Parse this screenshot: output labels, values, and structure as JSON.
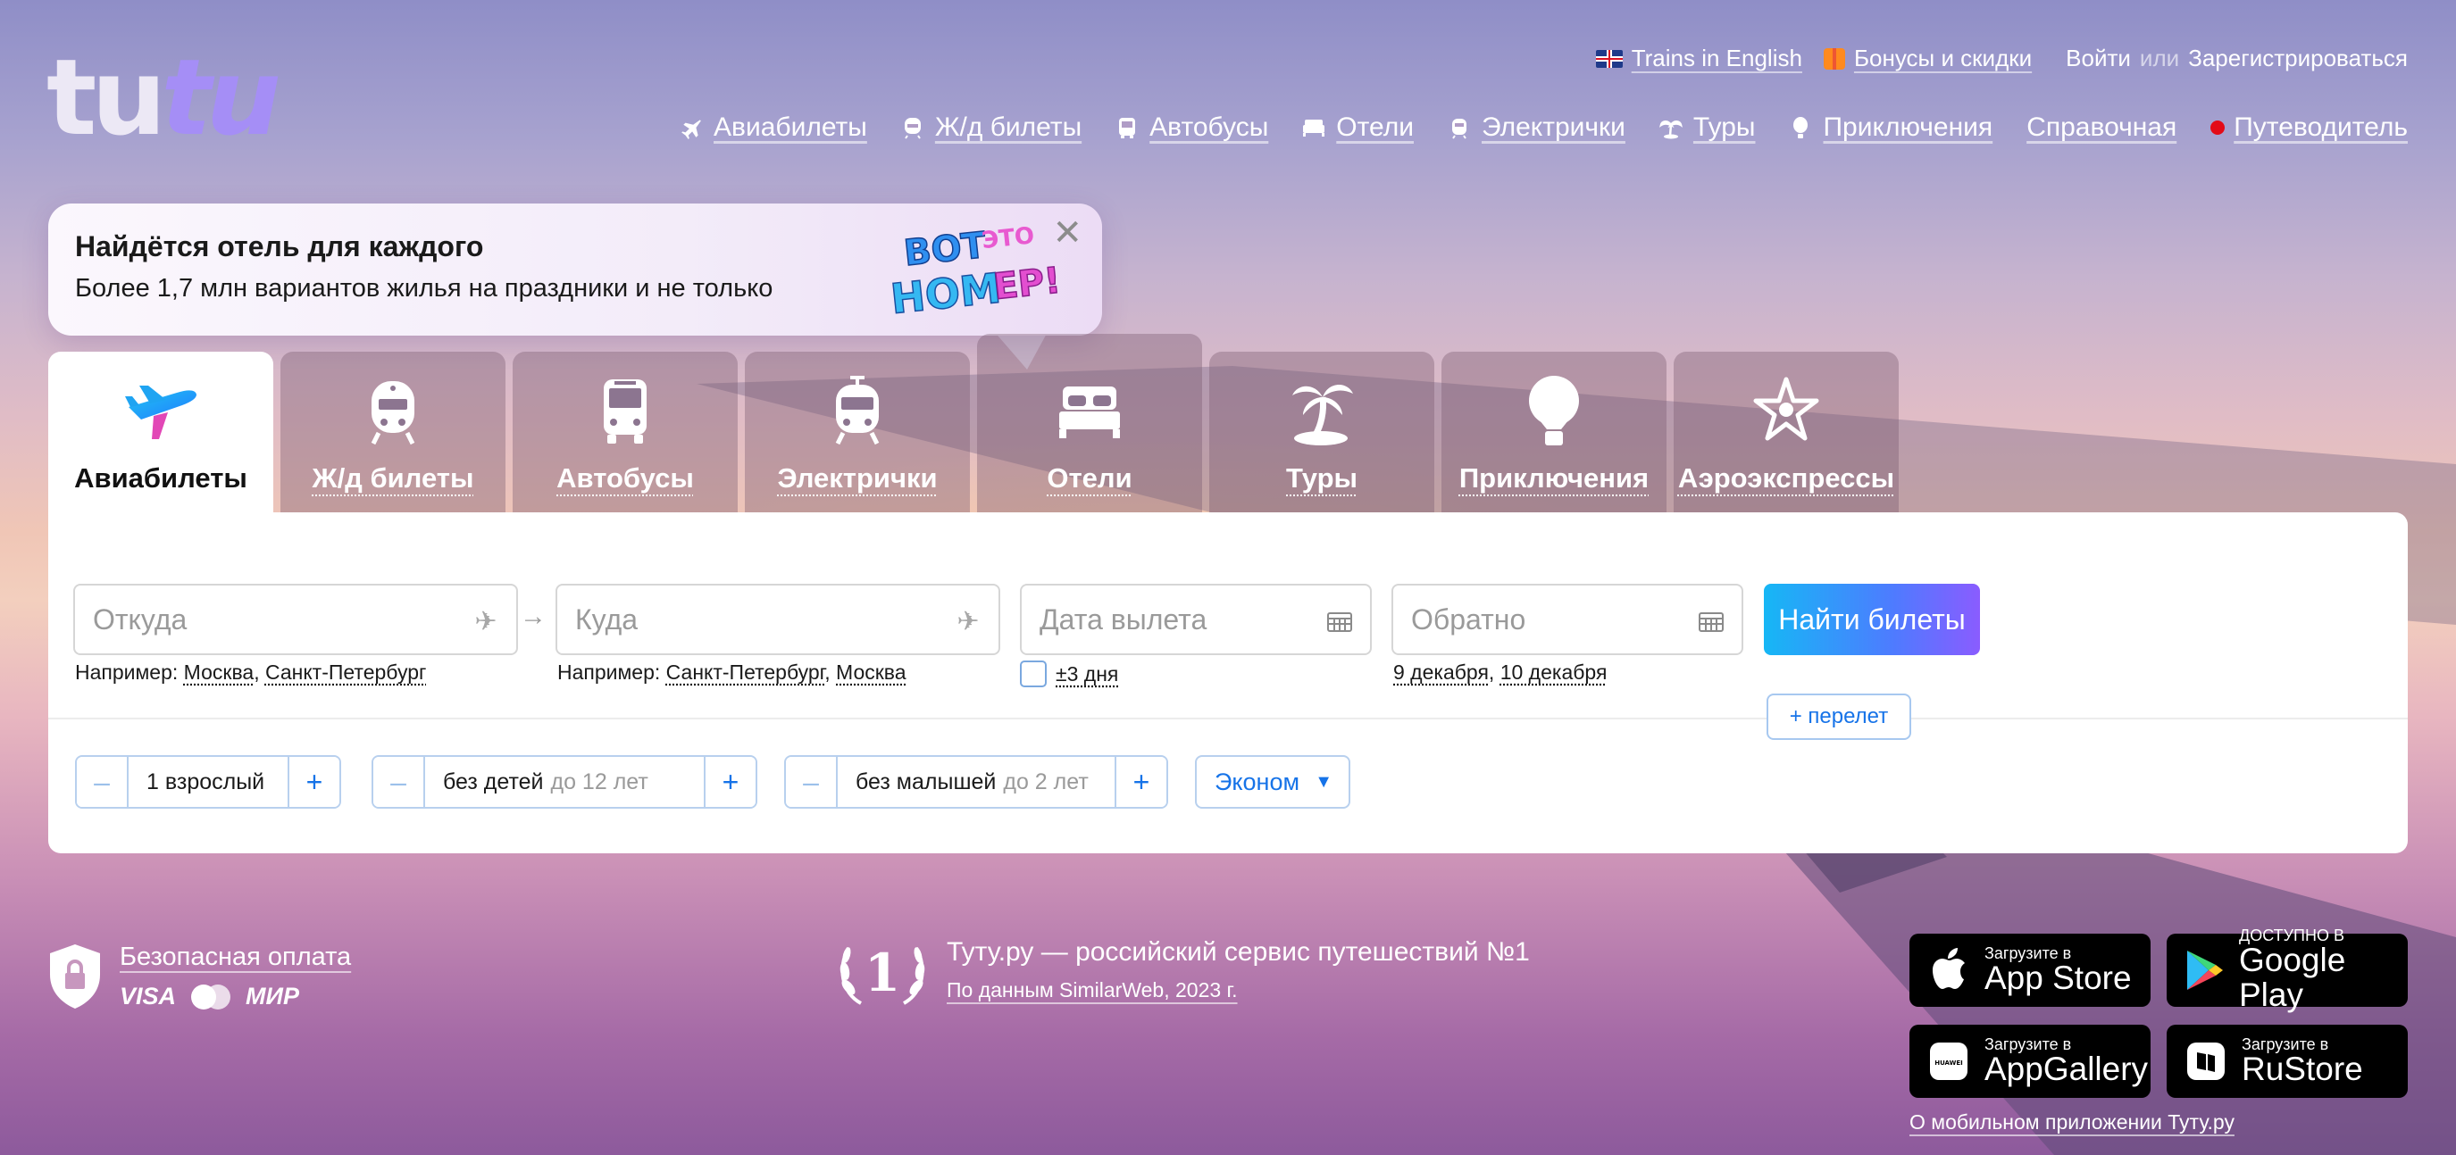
{
  "logo": {
    "part1": "tu",
    "part2": "tu"
  },
  "toplinks": {
    "trains_english": "Trains in English",
    "bonuses": "Бонусы и скидки",
    "login": "Войти",
    "or": "или",
    "register": "Зарегистрироваться"
  },
  "nav": [
    {
      "label": "Авиабилеты",
      "icon": "plane-icon"
    },
    {
      "label": "Ж/д билеты",
      "icon": "train-icon"
    },
    {
      "label": "Автобусы",
      "icon": "bus-icon"
    },
    {
      "label": "Отели",
      "icon": "bed-icon"
    },
    {
      "label": "Электрички",
      "icon": "suburban-train-icon"
    },
    {
      "label": "Туры",
      "icon": "palm-icon"
    },
    {
      "label": "Приключения",
      "icon": "balloon-icon"
    },
    {
      "label": "Справочная",
      "icon": ""
    },
    {
      "label": "Путеводитель",
      "icon": "red-dot"
    }
  ],
  "promo": {
    "title": "Найдётся отель для каждого",
    "subtitle": "Более 1,7 млн вариантов жилья на праздники и не только",
    "badge": "ВОТ ЭТО НОМЕР!",
    "close": "✕"
  },
  "tabs": [
    {
      "label": "Авиабилеты",
      "icon": "plane-icon",
      "active": true
    },
    {
      "label": "Ж/д билеты",
      "icon": "train-icon"
    },
    {
      "label": "Автобусы",
      "icon": "bus-icon"
    },
    {
      "label": "Электрички",
      "icon": "suburban-train-icon"
    },
    {
      "label": "Отели",
      "icon": "bed-icon"
    },
    {
      "label": "Туры",
      "icon": "palm-icon"
    },
    {
      "label": "Приключения",
      "icon": "balloon-icon"
    },
    {
      "label": "Аэроэкспрессы",
      "icon": "aeroexpress-icon"
    }
  ],
  "search": {
    "from_placeholder": "Откуда",
    "to_placeholder": "Куда",
    "date_placeholder": "Дата вылета",
    "return_placeholder": "Обратно",
    "from_hint_prefix": "Например:",
    "from_hint_1": "Москва",
    "from_hint_2": "Санкт-Петербург",
    "to_hint_prefix": "Например:",
    "to_hint_1": "Санкт-Петербург",
    "to_hint_2": "Москва",
    "flex_days": "±3 дня",
    "return_hint_1": "9 декабря",
    "return_hint_2": "10 декабря",
    "submit": "Найти билеты",
    "add_flight": "+ перелет"
  },
  "passengers": {
    "adults": "1 взрослый",
    "children": "без детей",
    "children_note": "до 12 лет",
    "infants": "без малышей",
    "infants_note": "до 2 лет",
    "minus": "–",
    "plus": "+",
    "class": "Эконом",
    "class_arrow": "▼"
  },
  "footer": {
    "safe_payment": "Безопасная оплата",
    "visa": "VISA",
    "mir": "МИР",
    "award_number": "1",
    "award_title": "Туту.ру — российский сервис путешествий №1",
    "award_source": "По данным SimilarWeb, 2023 г.",
    "stores": [
      {
        "small": "Загрузите в",
        "big": "App Store",
        "icon": "apple-icon"
      },
      {
        "small": "ДОСТУПНО В",
        "big": "Google Play",
        "icon": "google-play-icon"
      },
      {
        "small": "Загрузите в",
        "big": "AppGallery",
        "icon": "huawei-icon"
      },
      {
        "small": "Загрузите в",
        "big": "RuStore",
        "icon": "rustore-icon"
      }
    ],
    "mobile_link": "О мобильном приложении Туту.ру"
  }
}
